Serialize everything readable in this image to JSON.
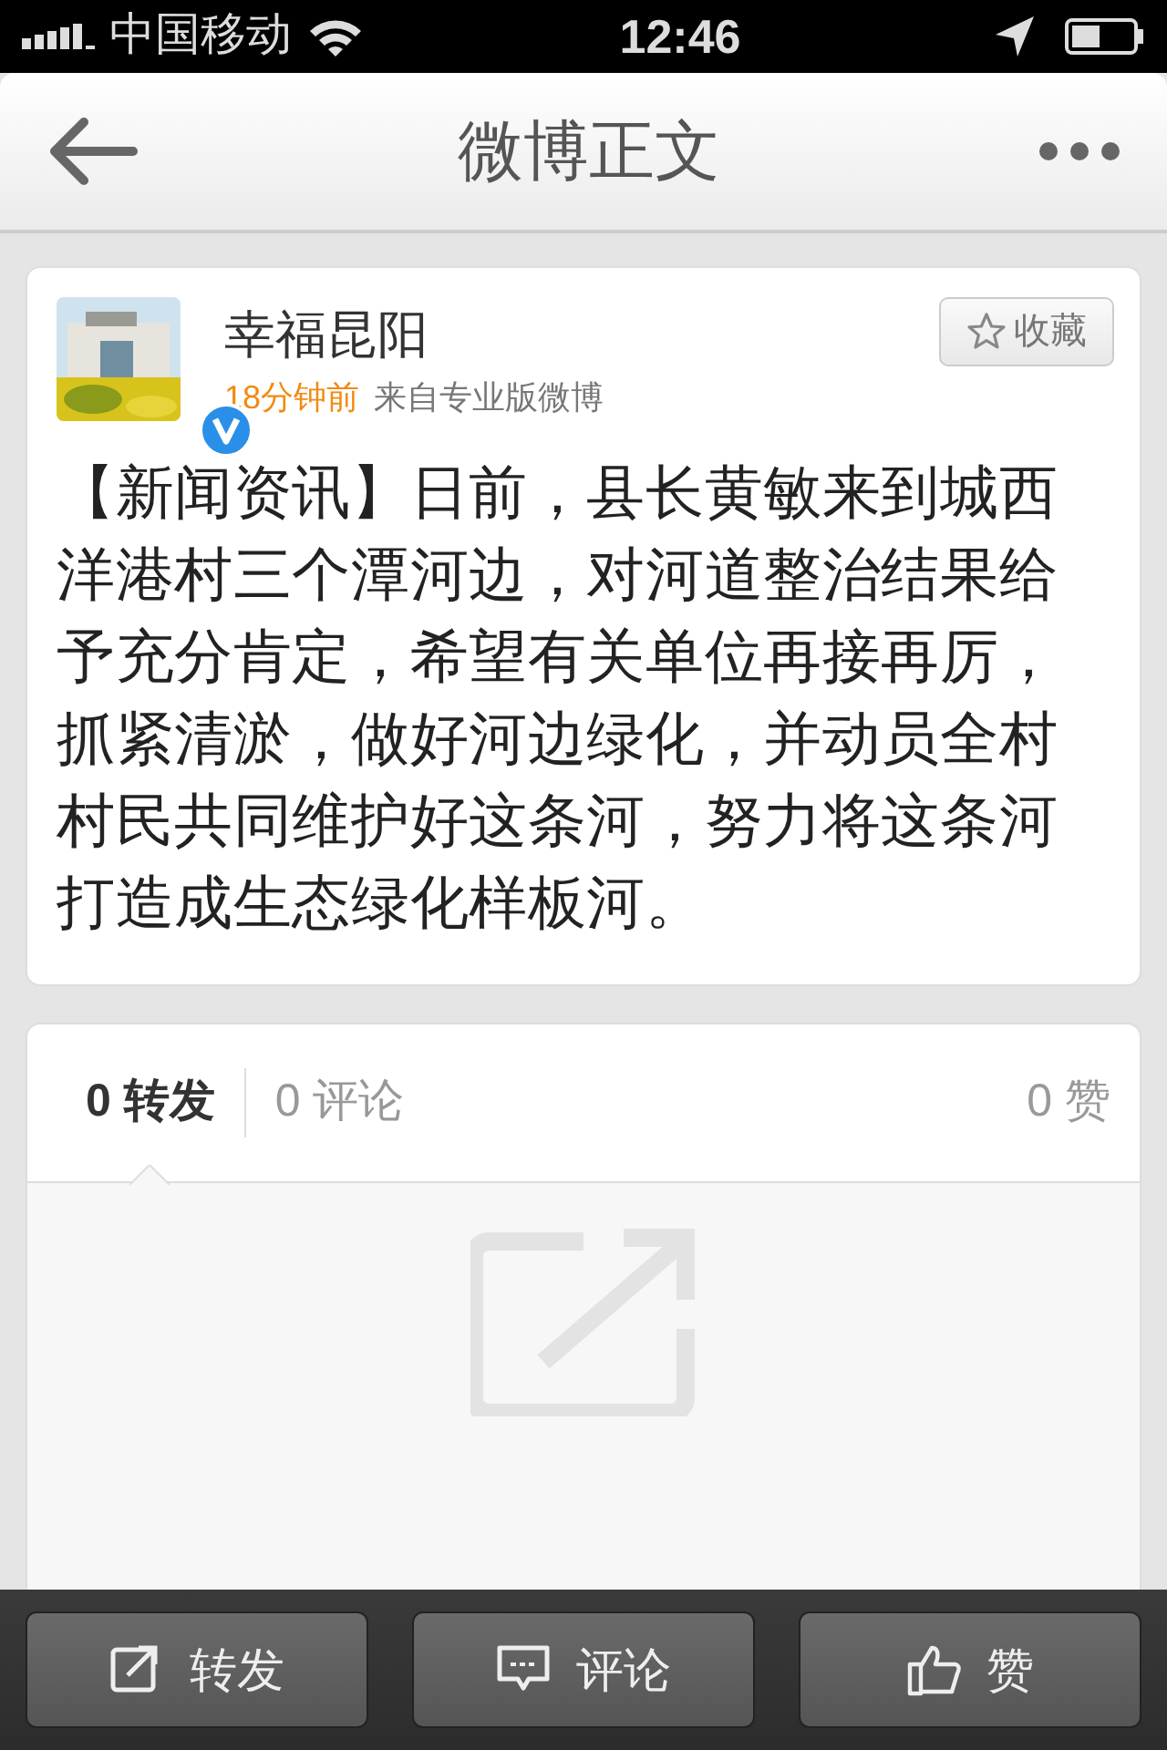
{
  "status_bar": {
    "carrier": "中国移动",
    "time": "12:46"
  },
  "nav_bar": {
    "title": "微博正文"
  },
  "post": {
    "author": "幸福昆阳",
    "verified": true,
    "time": "18分钟前",
    "source": "来自专业版微博",
    "favorite_button": "收藏",
    "text": "【新闻资讯】日前，县长黄敏来到城西洋港村三个潭河边，对河道整治结果给予充分肯定，希望有关单位再接再厉，抓紧清淤，做好河边绿化，并动员全村村民共同维护好这条河，努力将这条河打造成生态绿化样板河。"
  },
  "tabs": [
    {
      "label": "0 转发",
      "selected": true
    },
    {
      "label": "0 评论",
      "selected": false
    }
  ],
  "likes": "0 赞",
  "toolbar": [
    {
      "kind": "repost",
      "label": "转发"
    },
    {
      "kind": "comment",
      "label": "评论"
    },
    {
      "kind": "like",
      "label": "赞"
    }
  ]
}
